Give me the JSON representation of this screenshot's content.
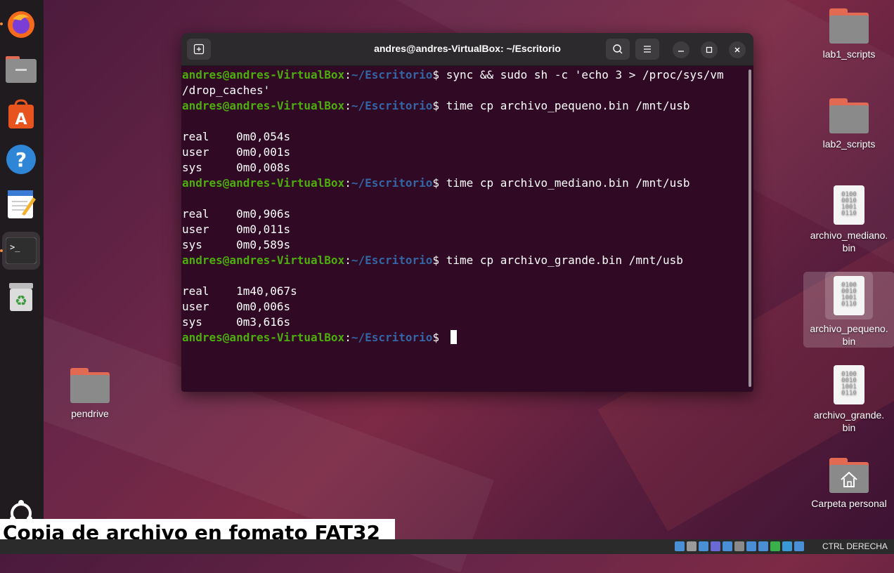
{
  "terminal": {
    "title": "andres@andres-VirtualBox: ~/Escritorio",
    "prompt_user": "andres@andres-VirtualBox",
    "prompt_path": "~/Escritorio",
    "lines": [
      {
        "kind": "prompt",
        "cmd": "sync && sudo sh -c 'echo 3 > /proc/sys/vm"
      },
      {
        "kind": "out",
        "text": "/drop_caches'"
      },
      {
        "kind": "prompt",
        "cmd": "time cp archivo_pequeno.bin /mnt/usb"
      },
      {
        "kind": "out",
        "text": ""
      },
      {
        "kind": "out",
        "text": "real    0m0,054s"
      },
      {
        "kind": "out",
        "text": "user    0m0,001s"
      },
      {
        "kind": "out",
        "text": "sys     0m0,008s"
      },
      {
        "kind": "prompt",
        "cmd": "time cp archivo_mediano.bin /mnt/usb"
      },
      {
        "kind": "out",
        "text": ""
      },
      {
        "kind": "out",
        "text": "real    0m0,906s"
      },
      {
        "kind": "out",
        "text": "user    0m0,011s"
      },
      {
        "kind": "out",
        "text": "sys     0m0,589s"
      },
      {
        "kind": "prompt",
        "cmd": "time cp archivo_grande.bin /mnt/usb"
      },
      {
        "kind": "out",
        "text": ""
      },
      {
        "kind": "out",
        "text": "real    1m40,067s"
      },
      {
        "kind": "out",
        "text": "user    0m0,006s"
      },
      {
        "kind": "out",
        "text": "sys     0m3,616s"
      },
      {
        "kind": "prompt",
        "cmd": "",
        "cursor": true
      }
    ]
  },
  "desktop": {
    "lab1": "lab1_scripts",
    "lab2": "lab2_scripts",
    "mediano": "archivo_mediano.\nbin",
    "pequeno": "archivo_pequeno.\nbin",
    "grande": "archivo_grande.\nbin",
    "home": "Carpeta personal",
    "pendrive": "pendrive",
    "binary_glyph": "0100\n0010\n1001\n0110"
  },
  "caption": "Copia de archivo en fomato FAT32",
  "statusbar": {
    "host_key": "CTRL DERECHA",
    "icon_colors": [
      "#4a8fd6",
      "#9a9a9a",
      "#4a8fd6",
      "#6a6ad6",
      "#4a8fd6",
      "#8a8a8a",
      "#4a8fd6",
      "#4a8fd6",
      "#3ab04a",
      "#3a9ad6",
      "#4a8fd6"
    ]
  },
  "dock": {
    "items": [
      "firefox",
      "files",
      "app-center",
      "help",
      "text-editor",
      "terminal",
      "trash"
    ],
    "active": "terminal",
    "bottom": "ubuntu-logo"
  },
  "colors": {
    "terminal_bg": "#300a24",
    "prompt_user": "#4ead0e",
    "prompt_path": "#3465a4",
    "folder_accent": "#e26a52"
  }
}
